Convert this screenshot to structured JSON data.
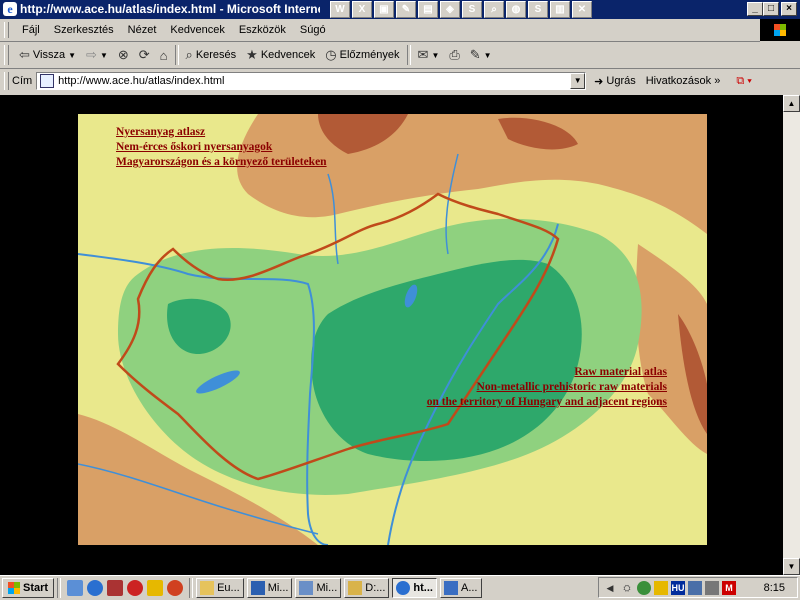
{
  "window": {
    "title": "http://www.ace.hu/atlas/index.html - Microsoft Internet Explorer",
    "quick_icons": [
      "W",
      "X",
      "▣",
      "✎",
      "▤",
      "◈",
      "S",
      "⌕",
      "◍",
      "S",
      "▥",
      "✕"
    ],
    "controls": {
      "minimize": "_",
      "maximize": "□",
      "close": "×"
    }
  },
  "menu": {
    "items": [
      "Fájl",
      "Szerkesztés",
      "Nézet",
      "Kedvencek",
      "Eszközök",
      "Súgó"
    ]
  },
  "toolbar": {
    "back": "Vissza",
    "search": "Keresés",
    "favorites": "Kedvencek",
    "history": "Előzmények"
  },
  "address": {
    "label": "Cím",
    "url": "http://www.ace.hu/atlas/index.html",
    "go": "Ugrás",
    "links": "Hivatkozások »"
  },
  "map": {
    "caption_hu": [
      "Nyersanyag atlasz",
      "Nem-érces őskori nyersanyagok",
      "Magyarországon és a környező területeken"
    ],
    "caption_en": [
      "Raw material atlas",
      "Non-metallic prehistoric raw materials",
      "on the territory of Hungary and adjacent regions"
    ],
    "colors": {
      "lowland": "#2ea86b",
      "hills": "#8fd17f",
      "plateau": "#e9e88c",
      "mountain": "#d9a066",
      "high": "#b25a36",
      "river": "#3f8fd8",
      "border": "#c04a1a"
    }
  },
  "taskbar": {
    "start": "Start",
    "tasks": [
      {
        "label": "Eu...",
        "icon": "folder",
        "active": false
      },
      {
        "label": "Mi...",
        "icon": "word",
        "active": false
      },
      {
        "label": "Mi...",
        "icon": "window",
        "active": false
      },
      {
        "label": "D:...",
        "icon": "search",
        "active": false
      },
      {
        "label": "ht...",
        "icon": "ie",
        "active": true
      },
      {
        "label": "A...",
        "icon": "app",
        "active": false
      }
    ],
    "tray_lang": "HU",
    "clock": "8:15"
  }
}
